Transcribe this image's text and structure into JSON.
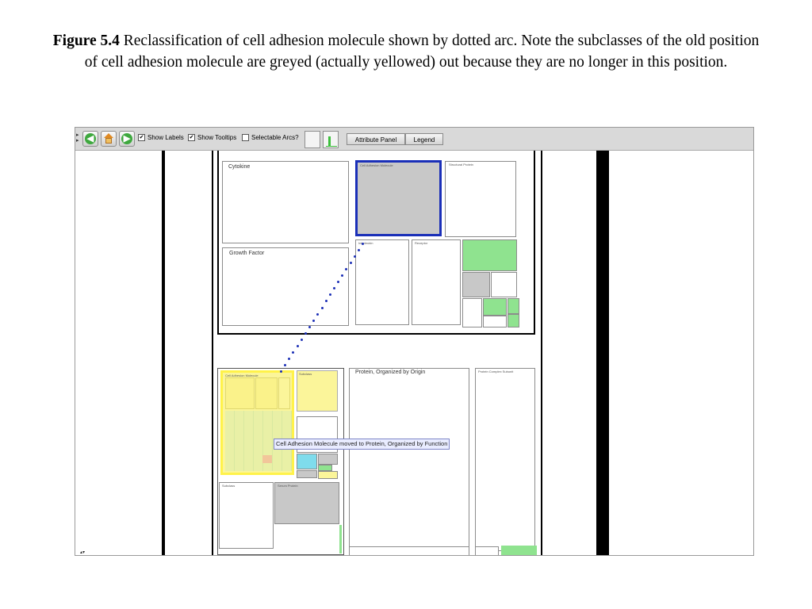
{
  "caption": {
    "label": "Figure  5.4",
    "text": "Reclassification of cell adhesion molecule shown by dotted arc.  Note the subclasses of the old position of cell adhesion molecule are greyed (actually yellowed) out because they are no longer in this position."
  },
  "toolbar": {
    "show_labels": {
      "label": "Show Labels",
      "checked": true
    },
    "show_tooltips": {
      "label": "Show Tooltips",
      "checked": true
    },
    "selectable_arcs": {
      "label": "Selectable Arcs?",
      "checked": false
    },
    "attribute_panel": "Attribute Panel",
    "legend": "Legend"
  },
  "treemap": {
    "top": {
      "cytokine": "Cytokine",
      "cell_adhesion": "Cell Adhesion Molecule",
      "structural": "Structural Protein",
      "growth_factor": "Growth Factor",
      "small_a": "Interleukin",
      "small_b": "Receptor"
    },
    "bottom": {
      "cell_adhesion_old": "Cell Adhesion Molecule",
      "yellow_sub": "Subclass",
      "by_origin": "Protein, Organized by Origin",
      "complex_subunit": "Protein Complex Subunit",
      "small_c": "Subclass",
      "serum": "Serum Protein"
    },
    "tooltip": "Cell Adhesion Molecule moved to Protein, Organized by Function"
  },
  "colors": {
    "highlight": "#1a2fb8",
    "yellow": "#fbf59a",
    "green": "#8fe38f",
    "gray": "#c8c8c8",
    "cyan": "#7fdcec"
  }
}
